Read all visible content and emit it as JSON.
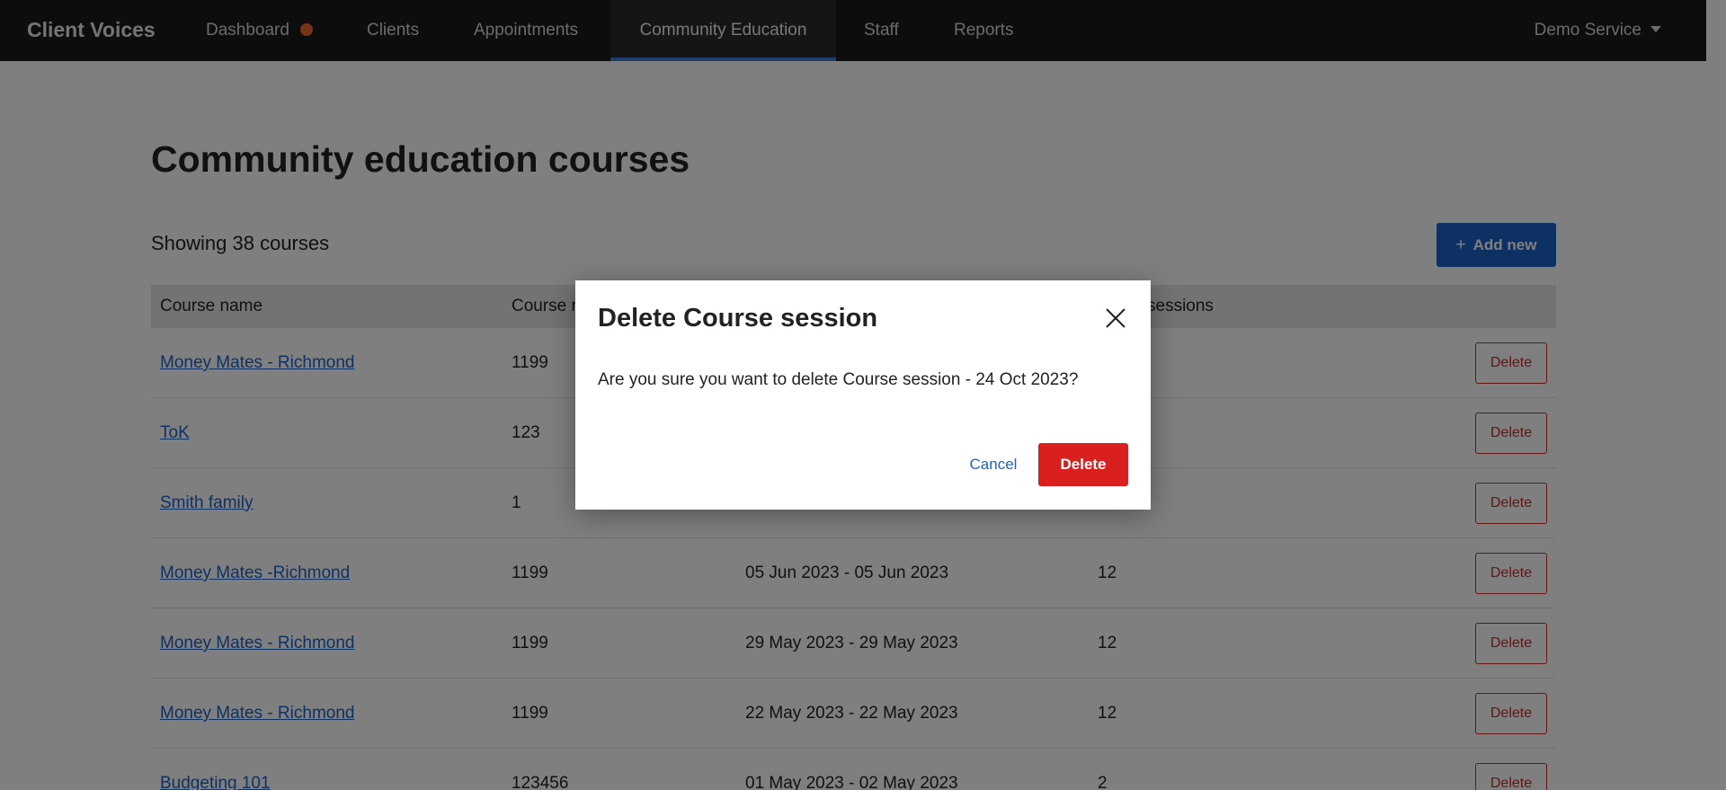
{
  "brand": "Client Voices",
  "nav": {
    "dashboard": "Dashboard",
    "clients": "Clients",
    "appointments": "Appointments",
    "community_education": "Community Education",
    "staff": "Staff",
    "reports": "Reports"
  },
  "service": "Demo Service",
  "page": {
    "title": "Community education courses",
    "showing": "Showing 38 courses",
    "add_new": "Add new"
  },
  "table": {
    "headers": {
      "course_name": "Course name",
      "course_number": "Course n",
      "sessions": "sessions"
    },
    "rows": [
      {
        "name": "Money Mates - Richmond",
        "number": "1199",
        "dates": "",
        "sessions": "",
        "delete": "Delete"
      },
      {
        "name": "ToK",
        "number": "123",
        "dates": "",
        "sessions": "",
        "delete": "Delete"
      },
      {
        "name": "Smith family",
        "number": "1",
        "dates": "",
        "sessions": "",
        "delete": "Delete"
      },
      {
        "name": "Money Mates -Richmond",
        "number": "1199",
        "dates": "05 Jun 2023 - 05 Jun 2023",
        "sessions": "12",
        "delete": "Delete"
      },
      {
        "name": "Money Mates - Richmond",
        "number": "1199",
        "dates": "29 May 2023 - 29 May 2023",
        "sessions": "12",
        "delete": "Delete"
      },
      {
        "name": "Money Mates - Richmond",
        "number": "1199",
        "dates": "22 May 2023 - 22 May 2023",
        "sessions": "12",
        "delete": "Delete"
      },
      {
        "name": "Budgeting 101",
        "number": "123456",
        "dates": "01 May 2023 - 02 May 2023",
        "sessions": "2",
        "delete": "Delete"
      }
    ]
  },
  "modal": {
    "title": "Delete Course session",
    "message": "Are you sure you want to delete Course session - 24 Oct 2023?",
    "cancel": "Cancel",
    "delete": "Delete"
  },
  "colors": {
    "nav_bg": "#1a1a1a",
    "accent": "#1d62c9",
    "danger": "#d9201f",
    "notification_dot": "#e86a2e"
  }
}
